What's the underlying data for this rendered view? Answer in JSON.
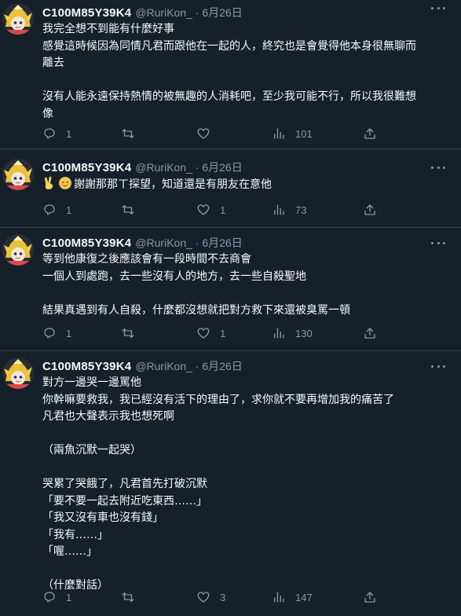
{
  "tweets": [
    {
      "name": "C100M85Y39K4",
      "handle": "@RuriKon_ · 6月26日",
      "lines": [
        "我完全想不到能有什麼好事",
        "感覺這時候因為同情凡君而跟他在一起的人，終究也是會覺得他本身很無聊而",
        "離去",
        "",
        "沒有人能永遠保持熱情的被無趣的人消耗吧，至少我可能不行，所以我很難想",
        "像"
      ],
      "replies": "1",
      "retweets": "",
      "likes": "",
      "views": "101"
    },
    {
      "name": "C100M85Y39K4",
      "handle": "@RuriKon_ · 6月26日",
      "emojis": [
        "victory-hand-emoji",
        "relieved-face-emoji"
      ],
      "lines": [
        "謝謝那那ㄒ探望，知道還是有朋友在意他"
      ],
      "replies": "1",
      "retweets": "",
      "likes": "1",
      "views": "73"
    },
    {
      "name": "C100M85Y39K4",
      "handle": "@RuriKon_ · 6月26日",
      "lines": [
        "等到他康復之後應該會有一段時間不去商會",
        "一個人到處跑，去一些沒有人的地方，去一些自殺聖地",
        "",
        "結果真遇到有人自殺，什麼都沒想就把對方救下來還被臭罵一頓"
      ],
      "replies": "1",
      "retweets": "",
      "likes": "1",
      "views": "130"
    },
    {
      "name": "C100M85Y39K4",
      "handle": "@RuriKon_ · 6月26日",
      "lines": [
        "對方一邊哭一邊罵他",
        "你幹嘛要救我，我已經沒有活下的理由了，求你就不要再增加我的痛苦了",
        "凡君也大聲表示我也想死啊",
        "",
        "（兩魚沉默一起哭）",
        "",
        "哭累了哭餓了，凡君首先打破沉默",
        "「要不要一起去附近吃東西……」",
        "「我又沒有車也沒有錢」",
        "「我有……」",
        "「喔……」",
        "",
        "（什麼對話）"
      ],
      "replies": "1",
      "retweets": "",
      "likes": "3",
      "views": "147"
    }
  ],
  "colors": {
    "background": "#15202b",
    "text": "#f7f9f9",
    "muted": "#8b98a5",
    "divider": "#38444d"
  }
}
